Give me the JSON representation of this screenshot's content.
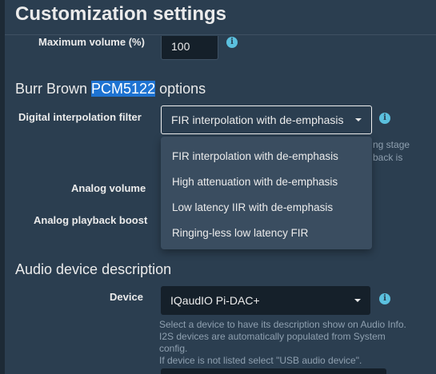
{
  "modal": {
    "title": "Customization settings"
  },
  "volume": {
    "label": "Maximum volume (%)",
    "value": "100"
  },
  "dac_section": {
    "title_prefix": "Burr Brown ",
    "title_highlight": "PCM5122",
    "title_suffix": " options"
  },
  "filter": {
    "label": "Digital interpolation filter",
    "selected": "FIR interpolation with de-emphasis",
    "options": [
      "FIR interpolation with de-emphasis",
      "High attenuation with de-emphasis",
      "Low latency IIR with de-emphasis",
      "Ringing-less low latency FIR"
    ],
    "help_partial_1": "ng stage",
    "help_partial_2": "back is"
  },
  "analog_volume": {
    "label": "Analog volume"
  },
  "analog_boost": {
    "label": "Analog playback boost"
  },
  "device_section": {
    "title": "Audio device description"
  },
  "device": {
    "label": "Device",
    "selected": "IQaudIO Pi-DAC+",
    "help_lines": [
      "Select a device to have its description show on Audio Info.",
      "I2S devices are automatically populated from System",
      "config.",
      "If device is not listed select \"USB audio device\"."
    ]
  },
  "info_icon_glyph": "i",
  "colors": {
    "accent": "#5bc0de",
    "highlight": "#1e73d2",
    "background": "#2b3e50"
  }
}
